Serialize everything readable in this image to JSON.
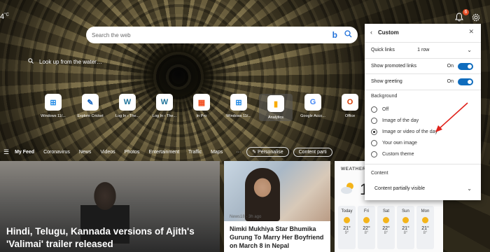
{
  "top": {
    "weather_temp": "4",
    "weather_unit": "°C",
    "notification_count": "6"
  },
  "search": {
    "placeholder": "Search the web"
  },
  "photo": {
    "caption": "Look up from the water…"
  },
  "quick_links": [
    {
      "label": "Windows 11/...",
      "icon": "windows-icon",
      "color": "#1e88e5"
    },
    {
      "label": "Explore Cricket",
      "icon": "cricket-icon",
      "color": "#1565c0"
    },
    {
      "label": "Log In ‹ The...",
      "icon": "wordpress-icon",
      "color": "#21759b"
    },
    {
      "label": "Log In ‹ The...",
      "icon": "wordpress-icon",
      "color": "#21759b"
    },
    {
      "label": "In Pro",
      "icon": "microsoft-icon",
      "color": "#f25022"
    },
    {
      "label": "Windows 11/...",
      "icon": "windows-icon",
      "color": "#1e88e5"
    },
    {
      "label": "Analytics",
      "icon": "analytics-icon",
      "color": "#f9ab00"
    },
    {
      "label": "Google Acco...",
      "icon": "google-icon",
      "color": "#4285f4"
    },
    {
      "label": "Office",
      "icon": "office-icon",
      "color": "#d83b01"
    }
  ],
  "feed": {
    "items": [
      "My Feed",
      "Coronavirus",
      "News",
      "Videos",
      "Photos",
      "Entertainment",
      "Traffic",
      "Maps"
    ],
    "more": "···",
    "personalise": "Personalise",
    "content_partial": "Content parti"
  },
  "cards": {
    "main_title": "Hindi, Telugu, Kannada versions of Ajith's 'Valimai' trailer released",
    "second_source": "News18 · 3h ago",
    "second_title": "Nimki Mukhiya Star Bhumika Gurung To Marry Her Boyfriend on March 8 in Nepal"
  },
  "weather": {
    "title": "WEATHER",
    "temp": "1",
    "days": [
      {
        "name": "Today",
        "hi": "21°",
        "lo": "9°"
      },
      {
        "name": "Fri",
        "hi": "22°",
        "lo": "8°"
      },
      {
        "name": "Sat",
        "hi": "22°",
        "lo": "8°"
      },
      {
        "name": "Sun",
        "hi": "21°",
        "lo": "8°"
      },
      {
        "name": "Mon",
        "hi": "21°",
        "lo": "8°"
      }
    ]
  },
  "panel": {
    "title": "Custom",
    "quick_links_label": "Quick links",
    "quick_links_value": "1 row",
    "promoted_label": "Show promoted links",
    "promoted_value": "On",
    "greeting_label": "Show greeting",
    "greeting_value": "On",
    "background_label": "Background",
    "background_options": [
      "Off",
      "Image of the day",
      "Image or video of the day",
      "Your own image",
      "Custom theme"
    ],
    "background_selected": "Image or video of the day",
    "content_label": "Content",
    "content_value": "Content partially visible"
  },
  "colors": {
    "accent": "#0f6cbd",
    "bing": "#1e6fd9",
    "arrow": "#e0231c",
    "badge": "#e04a22"
  }
}
